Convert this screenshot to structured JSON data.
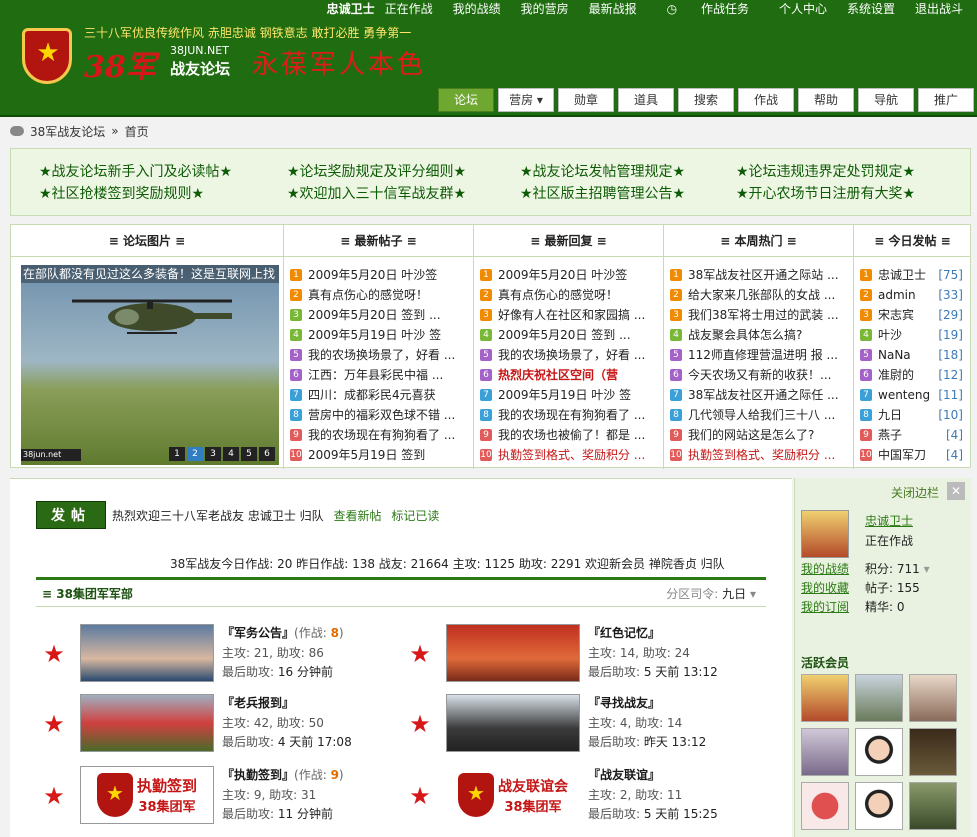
{
  "topnav": {
    "user": "忠诚卫士",
    "status": "正在作战",
    "items": [
      "我的战绩",
      "我的营房",
      "最新战报",
      "作战任务",
      "个人中心",
      "系统设置",
      "退出战斗"
    ]
  },
  "header": {
    "motto": "三十八军优良传统作风  赤胆忠诚  钢铁意志  敢打必胜  勇争第一",
    "brand_num": "38军",
    "brand_site": "38JUN.NET",
    "brand_forum": "战友论坛",
    "slogan": "永葆军人本色"
  },
  "mainnav": [
    "论坛",
    "营房",
    "勋章",
    "道具",
    "搜索",
    "作战",
    "帮助",
    "导航",
    "推广"
  ],
  "breadcrumb": {
    "home": "38军战友论坛",
    "sep": "»",
    "current": "首页"
  },
  "notice": [
    "★战友论坛新手入门及必读帖★",
    "★论坛奖励规定及评分细则★",
    "★战友论坛发帖管理规定★",
    "★论坛违规违界定处罚规定★",
    "★社区抢楼签到奖励规则★",
    "★欢迎加入三十信军战友群★",
    "★社区版主招聘管理公告★",
    "★开心农场节日注册有大奖★"
  ],
  "portal": {
    "pics": {
      "title": "≡ 论坛图片 ≡",
      "caption": "在部队都没有见过这么多装备！这是互联网上找",
      "pages": [
        "1",
        "2",
        "3",
        "4",
        "5",
        "6"
      ],
      "logo": "38jun.net"
    },
    "newposts": {
      "title": "≡ 最新帖子 ≡",
      "items": [
        "2009年5月20日 叶沙签",
        "真有点伤心的感觉呀！",
        "2009年5月20日 签到 ...",
        "2009年5月19日 叶沙 签",
        "我的农场换场景了，好看 ...",
        "江西：万年县彩民中福 ...",
        "四川：成都彩民4元喜获",
        "营房中的福彩双色球不错 ...",
        "我的农场现在有狗狗看了 ...",
        "2009年5月19日 签到"
      ]
    },
    "newreplies": {
      "title": "≡ 最新回复 ≡",
      "items": [
        "2009年5月20日 叶沙签",
        "真有点伤心的感觉呀！",
        "好像有人在社区和家园搞 ...",
        "2009年5月20日 签到 ...",
        "我的农场换场景了，好看 ...",
        "热烈庆祝社区空间（营",
        "2009年5月19日 叶沙 签",
        "我的农场现在有狗狗看了 ...",
        "我的农场也被偷了！都是 ...",
        "执勤签到格式、奖励积分 ..."
      ]
    },
    "hot": {
      "title": "≡ 本周热门 ≡",
      "items": [
        "38军战友社区开通之际站 ...",
        "给大家来几张部队的女战 ...",
        "我们38军将士用过的武装 ...",
        "战友聚会具体怎么搞?",
        "112师直修理营温进明 报 ...",
        "今天农场又有新的收获！...",
        "38军战友社区开通之际任 ...",
        "几代领导人给我们三十八 ...",
        "我们的网站这是怎么了?",
        "执勤签到格式、奖励积分 ..."
      ]
    },
    "today": {
      "title": "≡ 今日发帖 ≡",
      "items": [
        {
          "name": "忠诚卫士",
          "count": "[75]"
        },
        {
          "name": "admin",
          "count": "[33]"
        },
        {
          "name": "宋志宾",
          "count": "[29]"
        },
        {
          "name": "叶沙",
          "count": "[19]"
        },
        {
          "name": "NaNa",
          "count": "[18]"
        },
        {
          "name": "准尉的",
          "count": "[12]"
        },
        {
          "name": "wenteng",
          "count": "[11]"
        },
        {
          "name": "九日",
          "count": "[10]"
        },
        {
          "name": "燕子",
          "count": "[4]"
        },
        {
          "name": "中国军刀",
          "count": "[4]"
        }
      ]
    }
  },
  "main": {
    "post_button": "发帖",
    "welcome": "热烈欢迎三十八军老战友 忠诚卫士 归队",
    "view_new": "查看新帖",
    "mark_read": "标记已读",
    "stats": "38军战友今日作战: 20  昨日作战: 138  战友: 21664  主攻: 1125  助攻: 2291 欢迎新会员  禅院香贞 归队",
    "category": "≡ 38集团军军部",
    "moderator_label": "分区司令:",
    "moderator": "九日",
    "forums": [
      {
        "name": "『军务公告』",
        "today_label": "(作战: ",
        "today": "8",
        "today_end": ")",
        "stats": "主攻: 21, 助攻: 86",
        "last_label": "最后助攻: ",
        "last": "16 分钟前"
      },
      {
        "name": "『红色记忆』",
        "today_label": "",
        "today": "",
        "today_end": "",
        "stats": "主攻: 14, 助攻: 24",
        "last_label": "最后助攻: ",
        "last": "5 天前 13:12"
      },
      {
        "name": "『老兵报到』",
        "today_label": "",
        "today": "",
        "today_end": "",
        "stats": "主攻: 42, 助攻: 50",
        "last_label": "最后助攻: ",
        "last": "4 天前 17:08"
      },
      {
        "name": "『寻找战友』",
        "today_label": "",
        "today": "",
        "today_end": "",
        "stats": "主攻: 4, 助攻: 14",
        "last_label": "最后助攻: ",
        "last": "昨天 13:12"
      },
      {
        "name": "『执勤签到』",
        "today_label": "(作战: ",
        "today": "9",
        "today_end": ")",
        "stats": "主攻: 9, 助攻: 31",
        "last_label": "最后助攻: ",
        "last": "11 分钟前"
      },
      {
        "name": "『战友联谊』",
        "today_label": "",
        "today": "",
        "today_end": "",
        "stats": "主攻: 2, 助攻: 11",
        "last_label": "最后助攻: ",
        "last": "5 天前 15:25"
      }
    ],
    "signin_img_title": "执勤签到",
    "signin_img_sub": "38集团军",
    "union_img_title": "战友联谊会",
    "union_img_sub": "38集团军"
  },
  "side": {
    "close": "关闭边栏",
    "name": "忠诚卫士",
    "state": "正在作战",
    "links": [
      "我的战绩",
      "我的收藏",
      "我的订阅"
    ],
    "stats": [
      "积分: 711",
      "帖子: 155",
      "精华: 0"
    ],
    "active_title": "活跃会员"
  }
}
